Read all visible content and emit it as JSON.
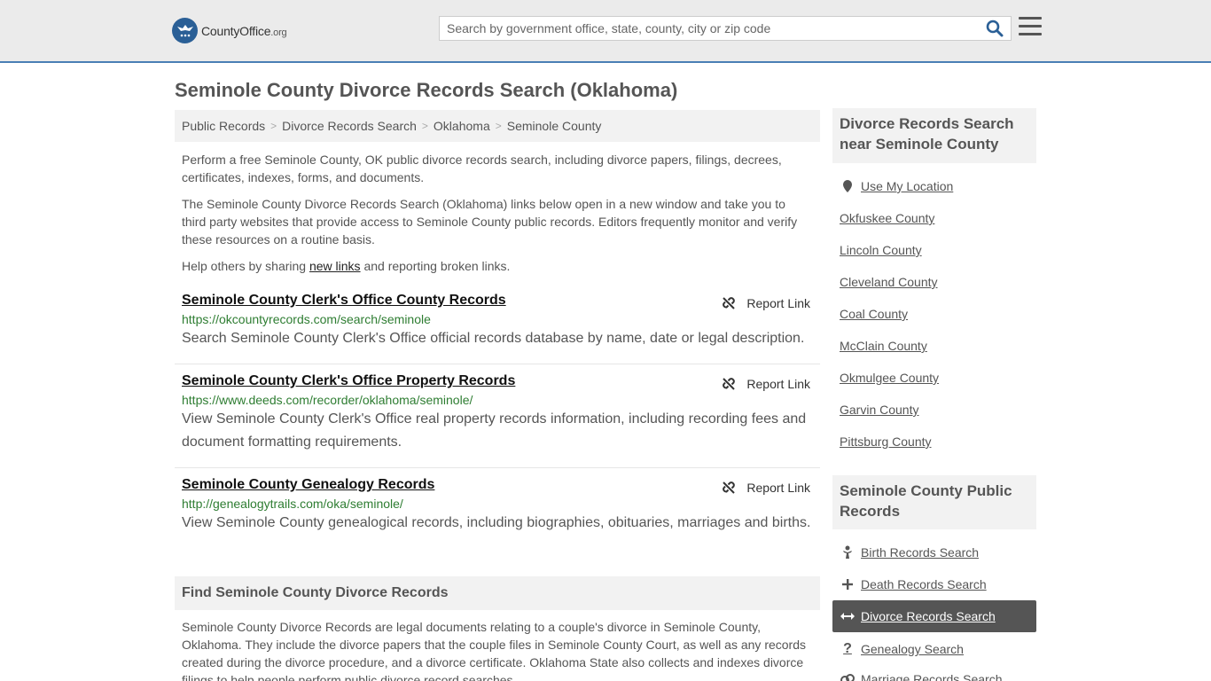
{
  "header": {
    "logo_county": "County",
    "logo_office": "Office",
    "logo_org": ".org",
    "search_placeholder": "Search by government office, state, county, city or zip code"
  },
  "page_title": "Seminole County Divorce Records Search (Oklahoma)",
  "breadcrumb": [
    "Public Records",
    "Divorce Records Search",
    "Oklahoma",
    "Seminole County"
  ],
  "intro": {
    "p1": "Perform a free Seminole County, OK public divorce records search, including divorce papers, filings, decrees, certificates, indexes, forms, and documents.",
    "p2": "The Seminole County Divorce Records Search (Oklahoma) links below open in a new window and take you to third party websites that provide access to Seminole County public records. Editors frequently monitor and verify these resources on a routine basis.",
    "p3_before": "Help others by sharing ",
    "p3_link": "new links",
    "p3_after": " and reporting broken links."
  },
  "records": [
    {
      "title": "Seminole County Clerk's Office County Records",
      "url": "https://okcountyrecords.com/search/seminole",
      "desc": "Search Seminole County Clerk's Office official records database by name, date or legal description.",
      "report": "Report Link"
    },
    {
      "title": "Seminole County Clerk's Office Property Records",
      "url": "https://www.deeds.com/recorder/oklahoma/seminole/",
      "desc": "View Seminole County Clerk's Office real property records information, including recording fees and document formatting requirements.",
      "report": "Report Link"
    },
    {
      "title": "Seminole County Genealogy Records",
      "url": "http://genealogytrails.com/oka/seminole/",
      "desc": "View Seminole County genealogical records, including biographies, obituaries, marriages and births.",
      "report": "Report Link"
    }
  ],
  "find_section": {
    "heading": "Find Seminole County Divorce Records",
    "text": "Seminole County Divorce Records are legal documents relating to a couple's divorce in Seminole County, Oklahoma. They include the divorce papers that the couple files in Seminole County Court, as well as any records created during the divorce procedure, and a divorce certificate. Oklahoma State also collects and indexes divorce filings to help people perform public divorce record searches."
  },
  "sidebar": {
    "nearby_heading": "Divorce Records Search near Seminole County",
    "use_location": "Use My Location",
    "nearby": [
      "Okfuskee County",
      "Lincoln County",
      "Cleveland County",
      "Coal County",
      "McClain County",
      "Okmulgee County",
      "Garvin County",
      "Pittsburg County"
    ],
    "public_heading": "Seminole County Public Records",
    "public_links": [
      {
        "label": "Birth Records Search",
        "icon": "baby-icon"
      },
      {
        "label": "Death Records Search",
        "icon": "cross-icon"
      },
      {
        "label": "Divorce Records Search",
        "icon": "arrows-icon"
      },
      {
        "label": "Genealogy Search",
        "icon": "question-icon"
      },
      {
        "label": "Marriage Records Search",
        "icon": "rings-icon"
      }
    ]
  },
  "colors": {
    "brand_blue": "#2a5f96",
    "url_green": "#2e7d32",
    "active_bg": "#555555"
  }
}
